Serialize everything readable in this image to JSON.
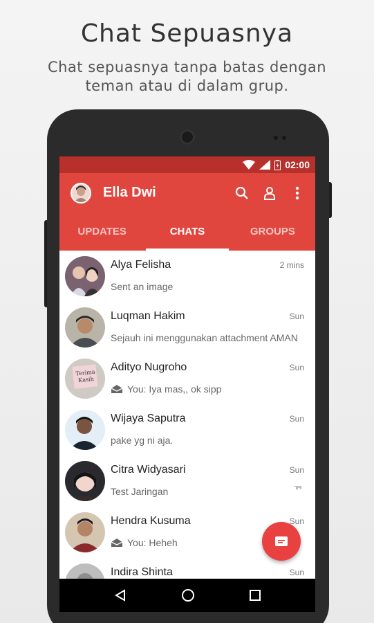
{
  "promo": {
    "title": "Chat Sepuasnya",
    "subtitle": "Chat sepuasnya tanpa batas dengan teman atau di dalam grup."
  },
  "status_bar": {
    "time": "02:00",
    "icons": [
      "wifi-icon",
      "signal-icon",
      "battery-icon"
    ]
  },
  "app_bar": {
    "title": "Ella Dwi",
    "actions": [
      "search-icon",
      "profile-icon",
      "more-vert-icon"
    ]
  },
  "tabs": [
    {
      "label": "UPDATES",
      "active": false
    },
    {
      "label": "CHATS",
      "active": true
    },
    {
      "label": "GROUPS",
      "active": false
    }
  ],
  "chats": [
    {
      "name": "Alya Felisha",
      "time": "2 mins",
      "message": "Sent an image",
      "sent_icon": false
    },
    {
      "name": "Luqman Hakim",
      "time": "Sun",
      "message": "Sejauh ini menggunakan attachment AMAN",
      "sent_icon": false
    },
    {
      "name": "Adityo Nugroho",
      "time": "Sun",
      "message": "You: Iya mas,, ok sipp",
      "sent_icon": true
    },
    {
      "name": "Wijaya Saputra",
      "time": "Sun",
      "message": "pake yg ni aja.",
      "sent_icon": false
    },
    {
      "name": "Citra Widyasari",
      "time": "Sun",
      "message": "Test Jaringan",
      "sent_icon": false,
      "muted_icon": true
    },
    {
      "name": "Hendra Kusuma",
      "time": "Sun",
      "message": "You: Heheh",
      "sent_icon": true
    },
    {
      "name": "Indira Shinta",
      "time": "Sun",
      "message": "",
      "sent_icon": false
    }
  ],
  "avatar_note_text": "Terima Kasih",
  "colors": {
    "primary": "#e0463e",
    "primary_dark": "#b8302c",
    "fab": "#e94040"
  },
  "nav": [
    "back-icon",
    "home-icon",
    "recents-icon"
  ]
}
